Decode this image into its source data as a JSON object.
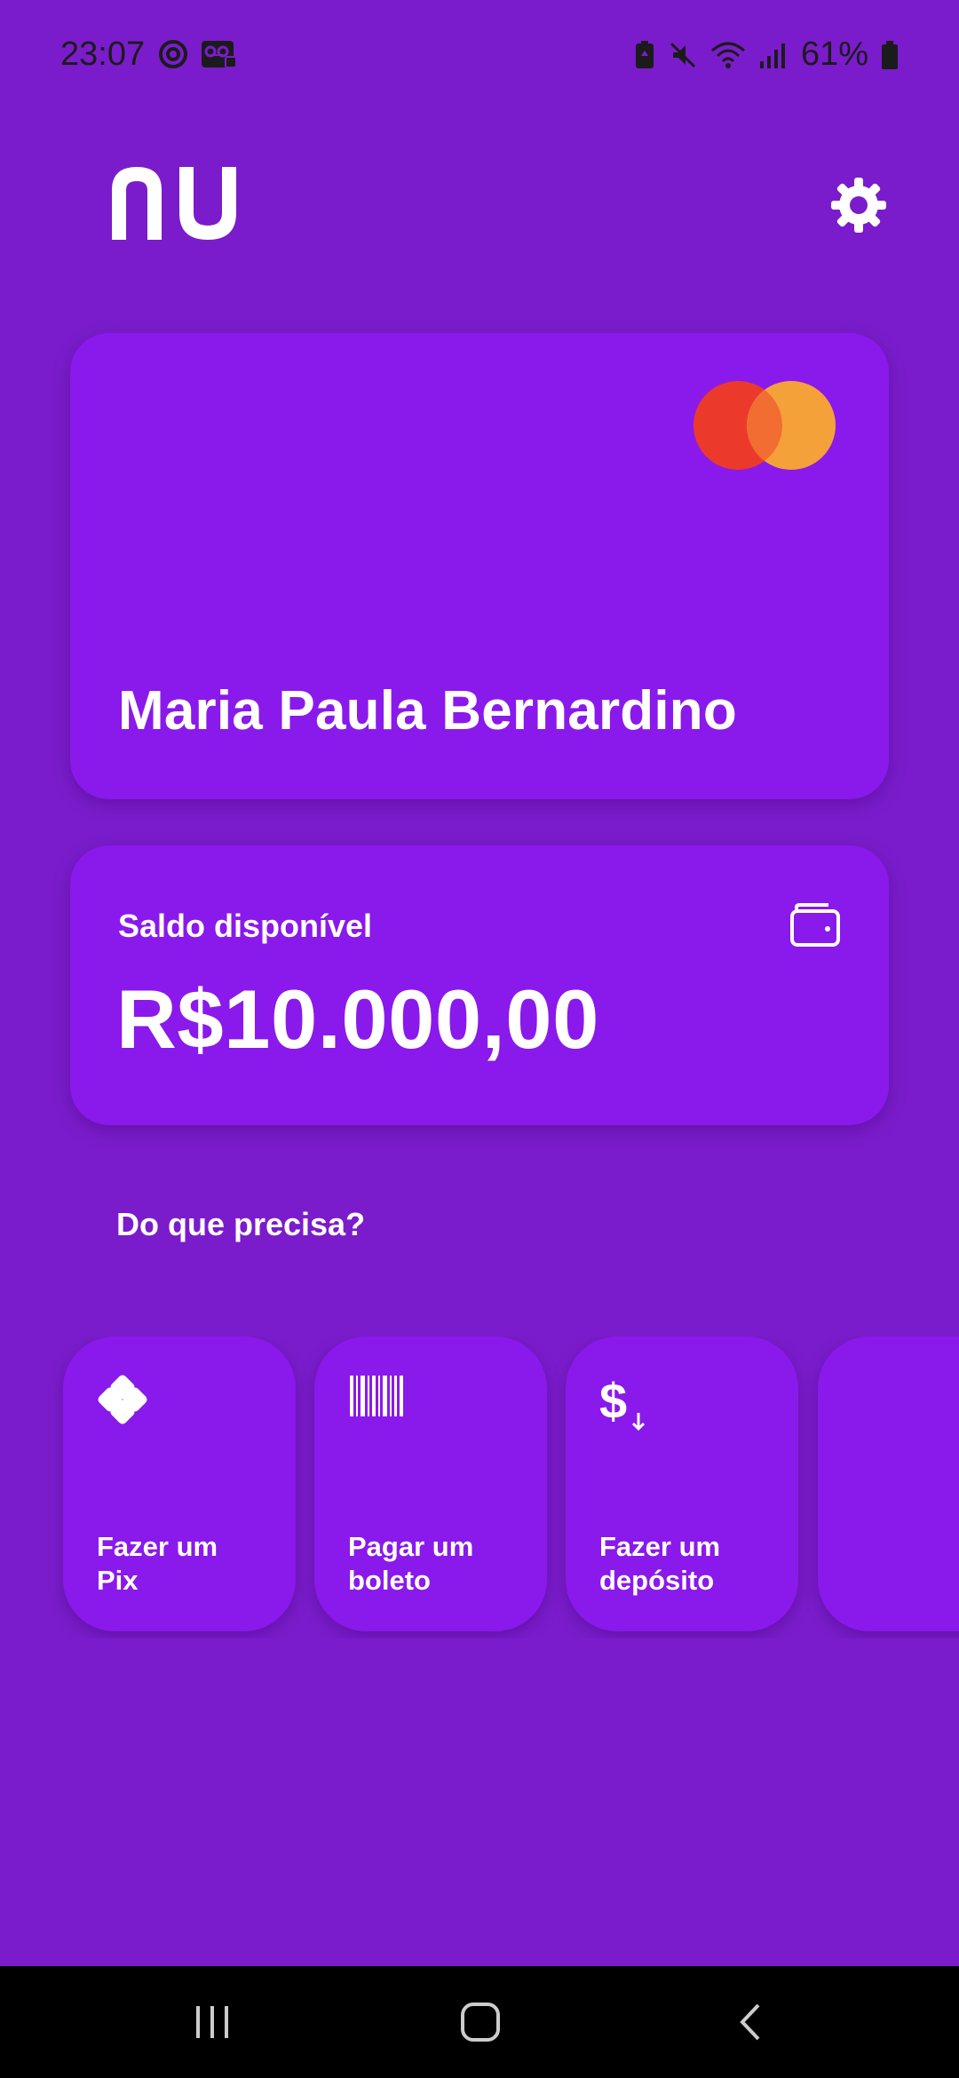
{
  "status_bar": {
    "time": "23:07",
    "battery": "61%",
    "icons_left": [
      "focus-icon",
      "voicemail-icon"
    ],
    "icons_right": [
      "battery-saver-icon",
      "mute-icon",
      "wifi-icon",
      "signal-icon",
      "battery-icon"
    ]
  },
  "header": {
    "logo_icon": "nu-logo",
    "settings_icon": "gear-icon"
  },
  "holder_card": {
    "name": "Maria Paula Bernardino",
    "brand_icon": "mastercard-logo"
  },
  "balance_card": {
    "label": "Saldo disponível",
    "value": "R$10.000,00",
    "icon": "wallet-icon"
  },
  "section": {
    "title": "Do que precisa?"
  },
  "actions": [
    {
      "label": "Fazer um\nPix",
      "icon": "pix-icon"
    },
    {
      "label": "Pagar um\nboleto",
      "icon": "barcode-icon"
    },
    {
      "label": "Fazer um\ndepósito",
      "icon": "deposit-icon"
    },
    {
      "label": "",
      "icon": ""
    }
  ],
  "nav": {
    "recents_icon": "recents-icon",
    "home_icon": "home-icon",
    "back_icon": "back-icon"
  },
  "colors": {
    "background": "#7A1CCB",
    "card": "#8A19EB",
    "text": "#FFFFFF"
  }
}
